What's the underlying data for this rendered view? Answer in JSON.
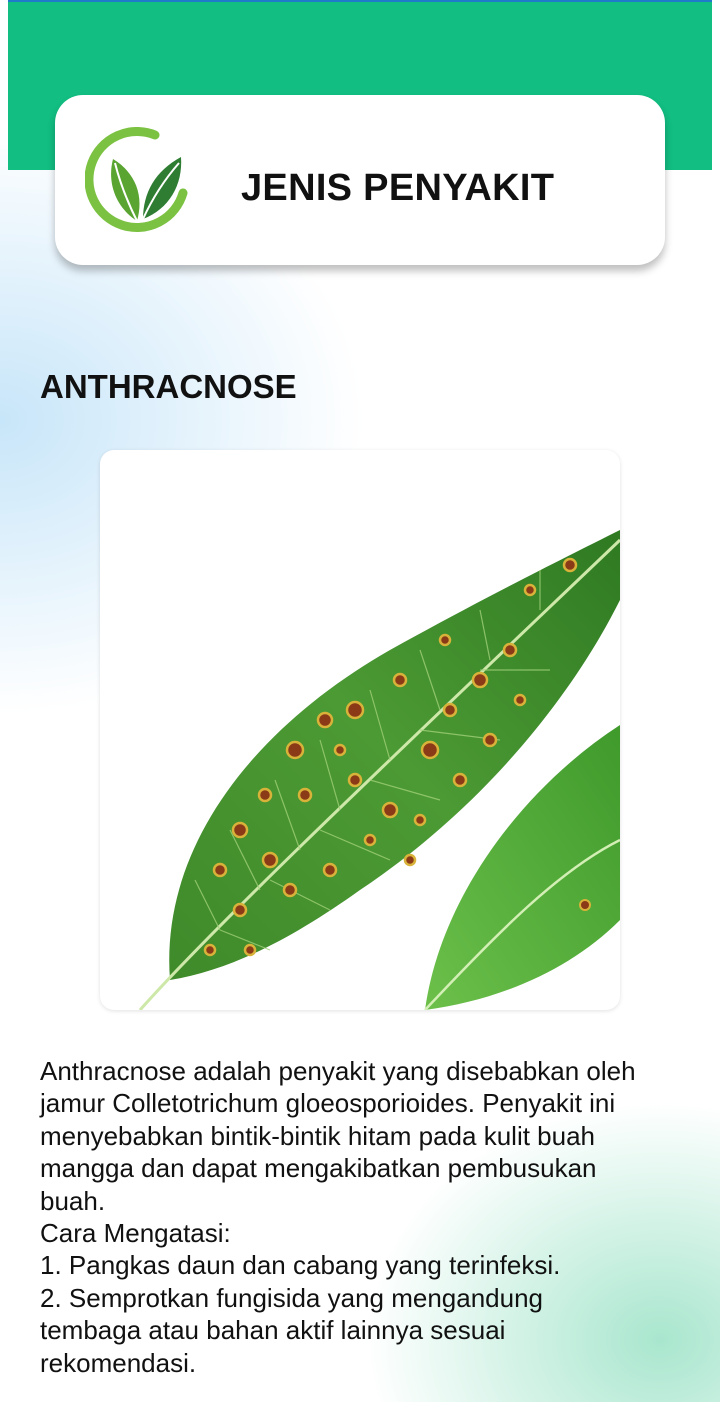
{
  "header": {
    "title": "JENIS PENYAKIT",
    "logo_icon": "leaf-logo-icon"
  },
  "disease": {
    "name": "ANTHRACNOSE",
    "image_icon": "diseased-mango-leaf-image",
    "description": "Anthracnose adalah penyakit yang disebabkan oleh\njamur Colletotrichum gloeosporioides. Penyakit ini\nmenyebabkan bintik-bintik hitam pada kulit buah\nmangga dan dapat mengakibatkan pembusukan\nbuah.\nCara Mengatasi:\n1. Pangkas daun dan cabang yang terinfeksi.\n2. Semprotkan fungisida yang mengandung\ntembaga atau bahan aktif lainnya sesuai\nrekomendasi."
  },
  "colors": {
    "header_band": "#12be82",
    "card": "#ffffff",
    "text": "#111111",
    "leaf_green": "#3f8f2c",
    "spot_brown": "#8a3a16"
  }
}
